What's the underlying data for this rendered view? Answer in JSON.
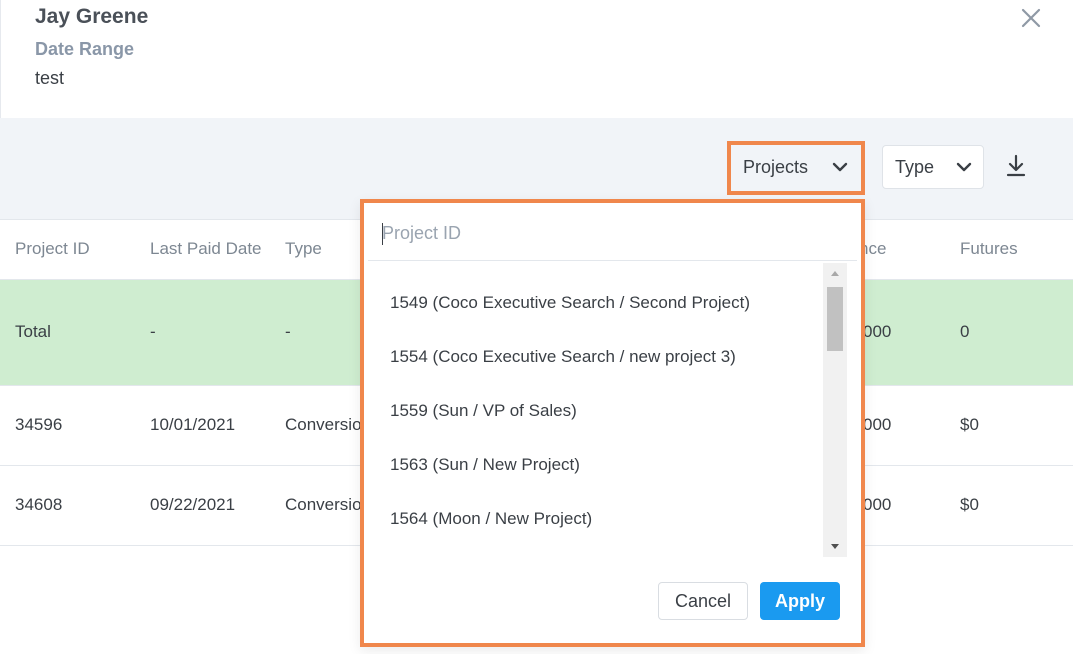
{
  "header": {
    "name": "Jay Greene",
    "date_range_label": "Date Range",
    "date_range_value": "test",
    "close_icon": "close-icon"
  },
  "toolbar": {
    "projects_label": "Projects",
    "type_label": "Type",
    "download_icon": "download-icon",
    "accent_color": "#f0874c"
  },
  "table": {
    "columns": [
      "Project ID",
      "Last Paid Date",
      "Type",
      "nce",
      "Futures"
    ],
    "total_row": {
      "project_id": "Total",
      "last_paid": "-",
      "type": "-",
      "balance": "000",
      "futures": "0",
      "bg": "#cfedd0"
    },
    "rows": [
      {
        "project_id": "34596",
        "last_paid": "10/01/2021",
        "type": "Conversio",
        "balance": "000",
        "futures": "$0"
      },
      {
        "project_id": "34608",
        "last_paid": "09/22/2021",
        "type": "Conversio",
        "balance": "000",
        "futures": "$0"
      }
    ]
  },
  "dropdown": {
    "search_placeholder": "Project ID",
    "search_value": "",
    "items": [
      "1549 (Coco Executive Search / Second Project)",
      "1554 (Coco Executive Search / new project 3)",
      "1559 (Sun / VP of Sales)",
      "1563 (Sun / New Project)",
      "1564 (Moon / New Project)"
    ],
    "cancel_label": "Cancel",
    "apply_label": "Apply",
    "apply_color": "#1a9af0"
  }
}
